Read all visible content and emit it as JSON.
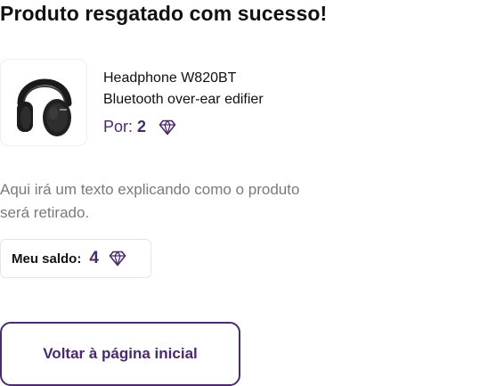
{
  "header": {
    "title": "Produto resgatado com sucesso!"
  },
  "product": {
    "image_icon": "headphone-image",
    "name_line1": "Headphone W820BT",
    "name_line2": "Bluetooth over-ear edifier",
    "price_label": "Por:",
    "price_value": "2",
    "price_icon": "diamond-icon"
  },
  "description": "Aqui irá um texto explicando como o produto será retirado.",
  "balance": {
    "label": "Meu saldo:",
    "value": "4",
    "icon": "diamond-icon"
  },
  "actions": {
    "back_label": "Voltar à página inicial"
  },
  "colors": {
    "accent": "#4b2a6b",
    "text": "#111111",
    "muted_text": "#7a7a7a",
    "border": "#e5e5e5"
  }
}
